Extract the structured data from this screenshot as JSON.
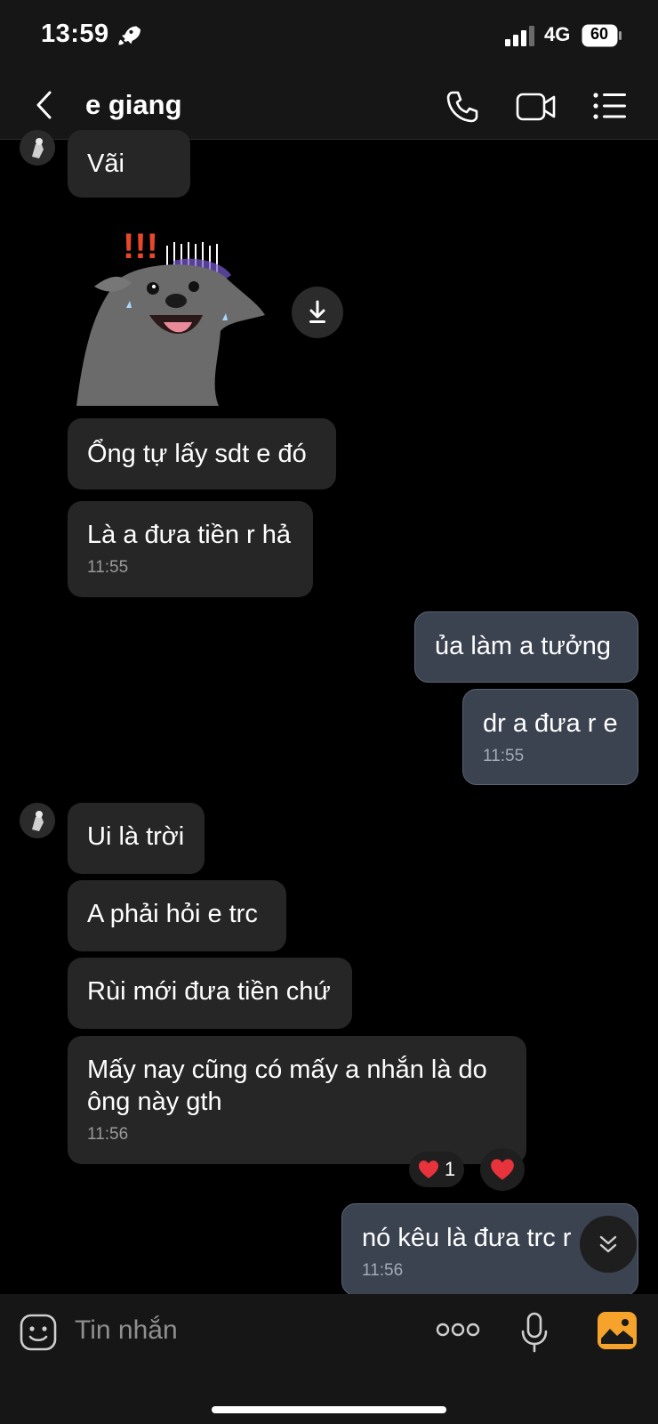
{
  "status_bar": {
    "time": "13:59",
    "network": "4G",
    "battery": "60"
  },
  "header": {
    "contact_name": "e giang"
  },
  "messages": [
    {
      "side": "in",
      "text": "Vãi"
    },
    {
      "side": "in",
      "text": "Ổng tự lấy sdt e đó"
    },
    {
      "side": "in",
      "text": "Là a đưa tiền r hả",
      "time": "11:55"
    },
    {
      "side": "out",
      "text": "ủa làm a tưởng"
    },
    {
      "side": "out",
      "text": "dr a đưa r e",
      "time": "11:55"
    },
    {
      "side": "in",
      "text": "Ui là trời"
    },
    {
      "side": "in",
      "text": "A phải hỏi e trc"
    },
    {
      "side": "in",
      "text": "Rùi mới đưa tiền chứ"
    },
    {
      "side": "in",
      "text": "Mấy nay cũng có mấy a nhắn là do ông này gth",
      "time": "11:56"
    },
    {
      "side": "out",
      "text": "nó kêu là đưa trc r",
      "time": "11:56"
    }
  ],
  "sticker": {
    "text": "!!!"
  },
  "reactions": {
    "heart_count": "1"
  },
  "composer": {
    "placeholder": "Tin nhắn"
  },
  "colors": {
    "bubble_in": "#262626",
    "bubble_out": "#3b4250",
    "accent_photo": "#f5a32a",
    "heart": "#e8323c"
  }
}
